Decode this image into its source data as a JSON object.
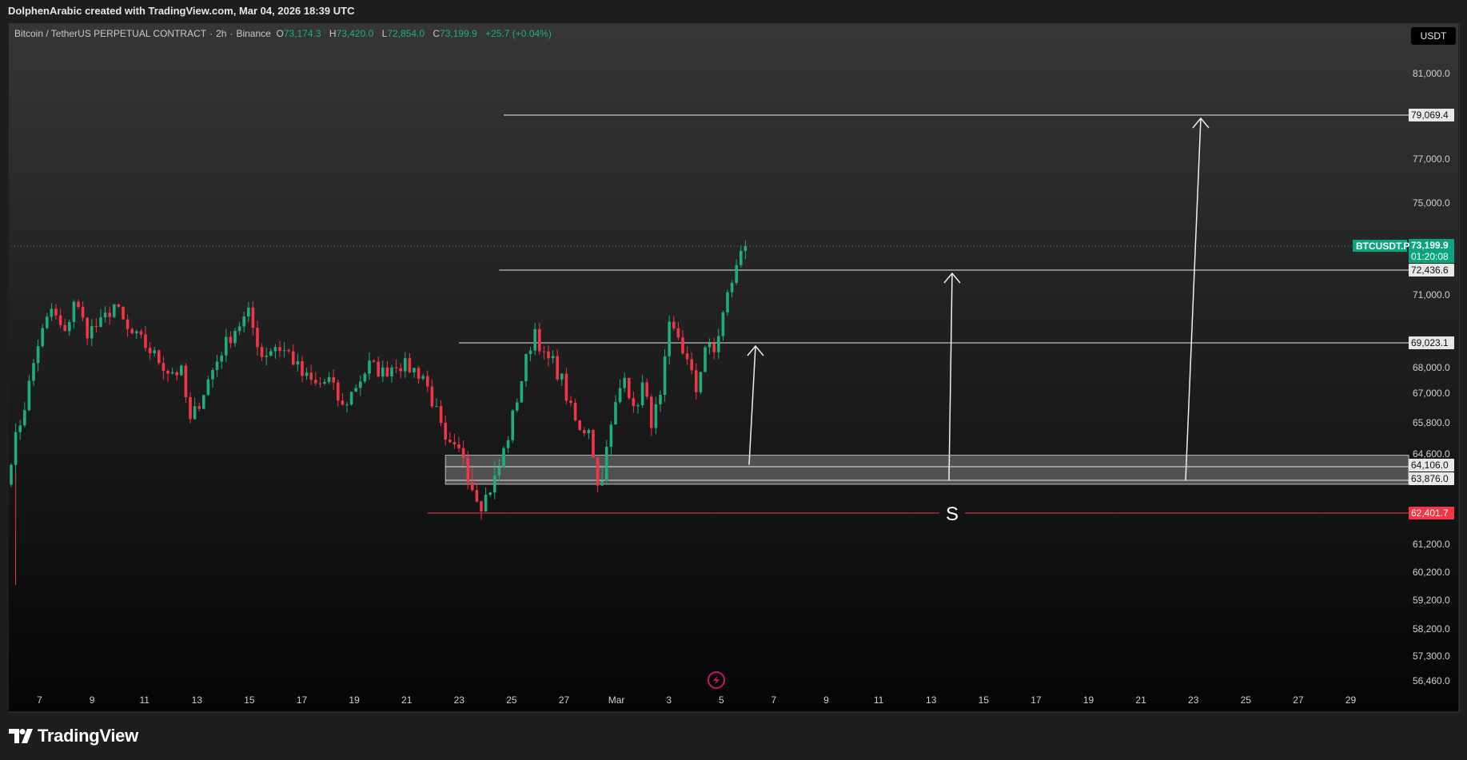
{
  "caption": "DolphenArabic created with TradingView.com, Mar 04, 2026 18:39 UTC",
  "header": {
    "symbol": "Bitcoin / TetherUS PERPETUAL CONTRACT",
    "interval": "2h",
    "exchange": "Binance",
    "ohlc": [
      {
        "label": "O",
        "value": "73,174.3"
      },
      {
        "label": "H",
        "value": "73,420.0"
      },
      {
        "label": "L",
        "value": "72,854.0"
      },
      {
        "label": "C",
        "value": "73,199.9"
      }
    ],
    "change": "+25.7 (+0.04%)"
  },
  "currency": "USDT",
  "brand": "TradingView",
  "colors": {
    "up": "#1eae7b",
    "down": "#f23645",
    "level_line": "#e6e6e6",
    "support_line": "#f23645",
    "zone_fill": "#9a9a9a",
    "last_price_tag": "#0aa57f"
  },
  "chart_data": {
    "type": "candlestick",
    "symbol": "BTCUSDT.P",
    "x_ticks": [
      "7",
      "9",
      "11",
      "13",
      "15",
      "17",
      "19",
      "21",
      "23",
      "25",
      "27",
      "Mar",
      "3",
      "5",
      "7",
      "9",
      "11",
      "13",
      "15",
      "17",
      "19",
      "21",
      "23",
      "25",
      "27",
      "29"
    ],
    "y_ticks": [
      "81,000.0",
      "77,000.0",
      "75,000.0",
      "71,000.0",
      "68,000.0",
      "67,000.0",
      "65,800.0",
      "64,600.0",
      "61,200.0",
      "60,200.0",
      "59,200.0",
      "58,200.0",
      "57,300.0",
      "56,460.0"
    ],
    "y_tick_values": [
      81000,
      77000,
      75000,
      71000,
      68000,
      67000,
      65800,
      64600,
      61200,
      60200,
      59200,
      58200,
      57300,
      56460
    ],
    "last_price": {
      "symbol": "BTCUSDT.P",
      "value": "73,199.9",
      "countdown": "01:20:08"
    },
    "levels": [
      {
        "value": 79069.4,
        "label": "79,069.4"
      },
      {
        "value": 72436.6,
        "label": "72,436.6"
      },
      {
        "value": 69023.1,
        "label": "69,023.1"
      },
      {
        "value": 64106.0,
        "label": "64,106.0"
      },
      {
        "value": 63876.0,
        "label": "63,876.0"
      }
    ],
    "support": {
      "value": 62401.7,
      "label": "62,401.7",
      "text": "S"
    },
    "zone": {
      "from": 63700,
      "to": 64550
    },
    "targets_from_zone": [
      69023.1,
      72436.6,
      79069.4
    ],
    "price_path": [
      [
        0,
        64500
      ],
      [
        3,
        66500
      ],
      [
        6,
        69000
      ],
      [
        9,
        70400
      ],
      [
        12,
        69300
      ],
      [
        14,
        70800
      ],
      [
        17,
        69500
      ],
      [
        20,
        69800
      ],
      [
        23,
        70600
      ],
      [
        26,
        69500
      ],
      [
        29,
        69100
      ],
      [
        32,
        68500
      ],
      [
        35,
        67900
      ],
      [
        38,
        67800
      ],
      [
        40,
        65800
      ],
      [
        44,
        67500
      ],
      [
        47,
        68700
      ],
      [
        50,
        69600
      ],
      [
        53,
        70200
      ],
      [
        56,
        68500
      ],
      [
        59,
        68900
      ],
      [
        62,
        68600
      ],
      [
        65,
        67700
      ],
      [
        68,
        67300
      ],
      [
        71,
        67500
      ],
      [
        74,
        66400
      ],
      [
        77,
        67300
      ],
      [
        80,
        68100
      ],
      [
        83,
        67800
      ],
      [
        86,
        68200
      ],
      [
        89,
        68000
      ],
      [
        92,
        67700
      ],
      [
        95,
        66200
      ],
      [
        97,
        64900
      ],
      [
        99,
        64700
      ],
      [
        101,
        64600
      ],
      [
        103,
        63600
      ],
      [
        105,
        62800
      ],
      [
        107,
        63500
      ],
      [
        109,
        64100
      ],
      [
        111,
        65300
      ],
      [
        113,
        66800
      ],
      [
        115,
        68300
      ],
      [
        117,
        69600
      ],
      [
        119,
        68400
      ],
      [
        121,
        68200
      ],
      [
        123,
        67500
      ],
      [
        125,
        66300
      ],
      [
        127,
        65400
      ],
      [
        129,
        65700
      ],
      [
        131,
        63600
      ],
      [
        133,
        64700
      ],
      [
        135,
        66500
      ],
      [
        137,
        67900
      ],
      [
        139,
        66200
      ],
      [
        141,
        67300
      ],
      [
        143,
        65900
      ],
      [
        145,
        66700
      ],
      [
        147,
        69600
      ],
      [
        149,
        69300
      ],
      [
        151,
        68200
      ],
      [
        153,
        67100
      ],
      [
        155,
        68900
      ],
      [
        157,
        68600
      ],
      [
        159,
        70200
      ],
      [
        161,
        71800
      ],
      [
        163,
        73100
      ],
      [
        164,
        73200
      ]
    ]
  }
}
